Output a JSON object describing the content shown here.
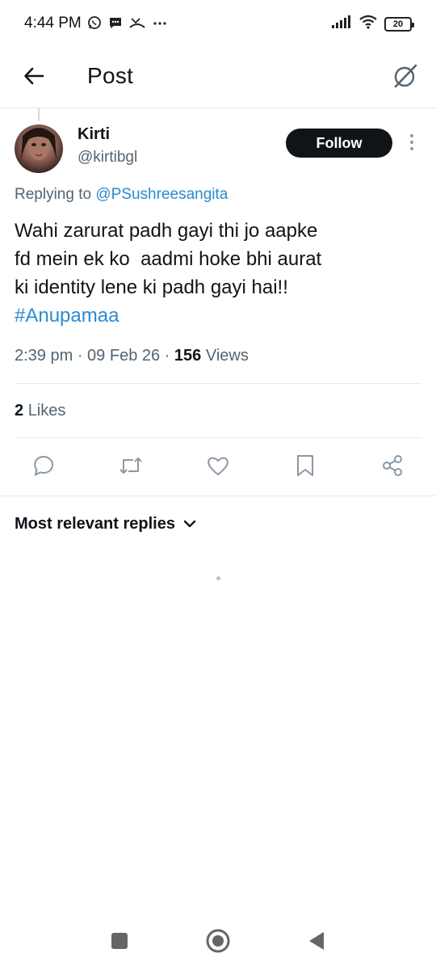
{
  "status_bar": {
    "time": "4:44 PM",
    "left_icons": [
      "whatsapp-icon",
      "message-icon",
      "missed-call-icon",
      "more-dots-icon"
    ],
    "battery": "20",
    "right_icons": [
      "signal-icon",
      "wifi-icon",
      "battery-icon"
    ]
  },
  "header": {
    "title": "Post",
    "back_icon": "arrow-left-icon",
    "grok_icon": "grok-icon"
  },
  "author": {
    "name": "Kirti",
    "handle": "@kirtibgl",
    "follow_label": "Follow"
  },
  "post": {
    "replying_prefix": "Replying to ",
    "replying_to": "@PSushreesangita",
    "text_lines": [
      "Wahi zarurat padh gayi thi jo aapke",
      "fd mein ek ko  aadmi hoke bhi aurat",
      "ki identity lene ki padh gayi hai!!"
    ],
    "hashtag": "#Anupamaa",
    "time": "2:39 pm",
    "date": "09 Feb 26",
    "views_count": "156",
    "views_label": "Views",
    "likes_count": "2",
    "likes_label": "Likes"
  },
  "actions": [
    "reply-icon",
    "repost-icon",
    "like-icon",
    "bookmark-icon",
    "share-icon"
  ],
  "replies": {
    "sort_label": "Most relevant replies"
  },
  "colors": {
    "accent": "#2a8bd1",
    "text": "#0f1419",
    "secondary": "#536471",
    "divider": "#e7e9ea",
    "follow_bg": "#0f1419",
    "icon_gray": "#8b98a5"
  },
  "navigation_bar": [
    "recent-apps-icon",
    "home-icon",
    "back-icon"
  ]
}
